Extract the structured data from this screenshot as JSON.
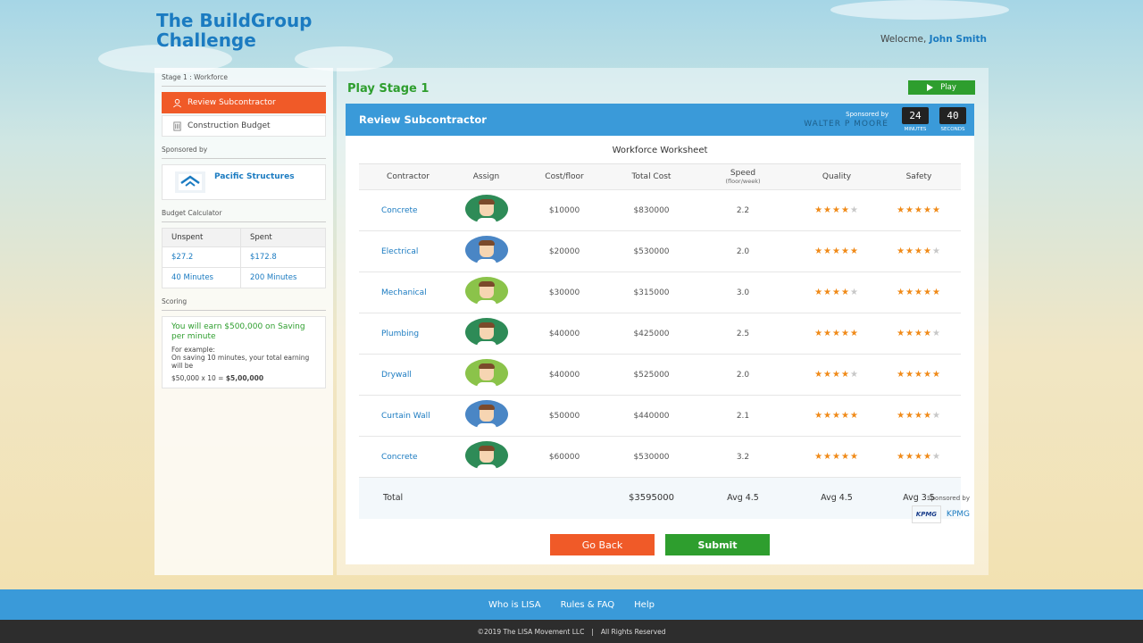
{
  "header": {
    "brand_title": "The BuildGroup Challenge",
    "welcome_text": "Welocme,",
    "user_name": "John Smith"
  },
  "sidebar": {
    "stage_label": "Stage 1 : Workforce",
    "items": [
      {
        "label": "Review Subcontractor",
        "icon": "person-hardhat-icon",
        "active": true
      },
      {
        "label": "Construction Budget",
        "icon": "building-icon",
        "active": false
      }
    ],
    "sponsored_label": "Sponsored by",
    "sponsor_name": "Pacific Structures",
    "budget_label": "Budget Calculator",
    "budget": {
      "headers": [
        "Unspent",
        "Spent"
      ],
      "rows": [
        [
          "$27.2",
          "$172.8"
        ],
        [
          "40 Minutes",
          "200 Minutes"
        ]
      ]
    },
    "scoring_label": "Scoring",
    "scoring": {
      "earn_text": "You will earn $500,000 on Saving per minute",
      "example_label": "For example:",
      "example_text": "On saving 10 minutes, your total earning will be",
      "formula": "$50,000 x 10 = ",
      "formula_result": "$5,00,000"
    }
  },
  "main": {
    "stage_title": "Play Stage 1",
    "play_label": "Play",
    "card_title": "Review Subcontractor",
    "sponsored_by": "Sponsored by",
    "sponsor_firm": "WALTER P MOORE",
    "timer": {
      "minutes": "24",
      "seconds": "40",
      "minutes_label": "MINUTES",
      "seconds_label": "SECONDS"
    },
    "worksheet_title": "Workforce Worksheet",
    "columns": [
      "Contractor",
      "Assign",
      "Cost/floor",
      "Total Cost",
      "Speed",
      "Quality",
      "Safety"
    ],
    "speed_unit": "(floor/week)",
    "rows": [
      {
        "contractor": "Concrete",
        "cost_floor": "$10000",
        "total": "$830000",
        "speed": "2.2",
        "quality": 4,
        "safety": 5,
        "avatar_color": "#2e8b57"
      },
      {
        "contractor": "Electrical",
        "cost_floor": "$20000",
        "total": "$530000",
        "speed": "2.0",
        "quality": 5,
        "safety": 4,
        "avatar_color": "#4a86c5"
      },
      {
        "contractor": "Mechanical",
        "cost_floor": "$30000",
        "total": "$315000",
        "speed": "3.0",
        "quality": 4,
        "safety": 5,
        "avatar_color": "#8bc34a"
      },
      {
        "contractor": "Plumbing",
        "cost_floor": "$40000",
        "total": "$425000",
        "speed": "2.5",
        "quality": 5,
        "safety": 4,
        "avatar_color": "#2e8b57"
      },
      {
        "contractor": "Drywall",
        "cost_floor": "$40000",
        "total": "$525000",
        "speed": "2.0",
        "quality": 4,
        "safety": 5,
        "avatar_color": "#8bc34a"
      },
      {
        "contractor": "Curtain Wall",
        "cost_floor": "$50000",
        "total": "$440000",
        "speed": "2.1",
        "quality": 5,
        "safety": 4,
        "avatar_color": "#4a86c5"
      },
      {
        "contractor": "Concrete",
        "cost_floor": "$60000",
        "total": "$530000",
        "speed": "3.2",
        "quality": 5,
        "safety": 4,
        "avatar_color": "#2e8b57"
      }
    ],
    "total": {
      "label": "Total",
      "cost": "$3595000",
      "speed": "Avg 4.5",
      "quality": "Avg 4.5",
      "safety": "Avg 3.5"
    },
    "go_back_label": "Go Back",
    "submit_label": "Submit",
    "footer_sponsored": "Sponsored by",
    "footer_sponsor": "KPMG",
    "footer_sponsor_logo": "KPMG"
  },
  "footer": {
    "links": [
      "Who is LISA",
      "Rules & FAQ",
      "Help"
    ],
    "copyright": "©2019 The LISA Movement LLC",
    "rights": "All Rights Reserved"
  },
  "colors": {
    "accent_blue": "#3a9ad9",
    "orange": "#f05a28",
    "green": "#2e9e2e",
    "star": "#f08a18"
  }
}
